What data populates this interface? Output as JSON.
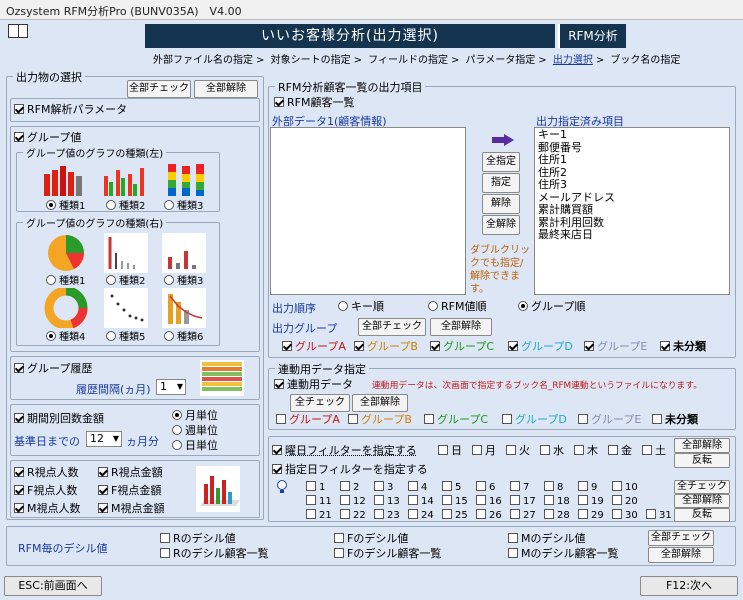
{
  "window": {
    "title": "Ozsystem RFM分析Pro (BUNV035A)　V4.00"
  },
  "header": {
    "title": "いいお客様分析(出力選択)",
    "badge": "RFM分析"
  },
  "nav": [
    {
      "label": "外部ファイル名の指定",
      "sep": ">"
    },
    {
      "label": "対象シートの指定",
      "sep": ">"
    },
    {
      "label": "フィールドの指定",
      "sep": ">"
    },
    {
      "label": "パラメータ指定",
      "sep": ">"
    },
    {
      "label": "出力選択",
      "sep": ">",
      "current": true
    },
    {
      "label": "ブック名の指定",
      "sep": ""
    }
  ],
  "output_section": {
    "title": "出力物の選択",
    "check_all": "全部チェック",
    "clear_all": "全部解除",
    "rfm_params": "RFM解析パラメータ",
    "group_values": "グループ値",
    "left_chart_title": "グループ値のグラフの種類(左)",
    "left_types": [
      "種類1",
      "種類2",
      "種類3"
    ],
    "right_chart_title": "グループ値のグラフの種類(右)",
    "right_types": [
      "種類1",
      "種類2",
      "種類3",
      "種類4",
      "種類5",
      "種類6"
    ],
    "history": "グループ履歴",
    "history_interval_label": "履歴間隔(ヵ月)",
    "history_interval_value": "1",
    "period_count": "期間別回数金額",
    "base_date_label": "基準日までの",
    "base_date_value": "12",
    "base_date_unit": "ヵ月分",
    "units": [
      "月単位",
      "週単位",
      "日単位"
    ],
    "viewpoints": [
      "R視点人数",
      "R視点金額",
      "F視点人数",
      "F視点金額",
      "M視点人数",
      "M視点金額"
    ]
  },
  "rfm_list": {
    "title": "RFM分析顧客一覧の出力項目",
    "rfm_customer_list": "RFM顧客一覧",
    "external_label": "外部データ1(顧客情報)",
    "specified_label": "出力指定済み項目",
    "specified_items": [
      "キー1",
      "郵便番号",
      "住所1",
      "住所2",
      "住所3",
      "メールアドレス",
      "累計購買額",
      "累計利用回数",
      "最終来店日"
    ],
    "btn_all_specify": "全指定",
    "btn_specify": "指定",
    "btn_release": "解除",
    "btn_all_release": "全解除",
    "hint": "ダブルクリックでも指定/解除できます。",
    "order_label": "出力順序",
    "order_options": [
      "キー順",
      "RFM値順",
      "グループ順"
    ],
    "group_label": "出力グループ",
    "check_all": "全部チェック",
    "clear_all": "全部解除",
    "groups": [
      "グループA",
      "グループB",
      "グループC",
      "グループD",
      "グループE",
      "未分類"
    ]
  },
  "link": {
    "title": "連動用データ指定",
    "link_data": "連動用データ",
    "note": "連動用データは、次画面で指定するブック名_RFM連動というファイルになります。",
    "check_all": "全チェック",
    "clear_all": "全部解除",
    "groups": [
      "グループA",
      "グループB",
      "グループC",
      "グループD",
      "グループE",
      "未分類"
    ]
  },
  "filters": {
    "weekday_filter": "曜日フィルターを指定する",
    "weekdays": [
      "日",
      "月",
      "火",
      "水",
      "木",
      "金",
      "土"
    ],
    "clear_all": "全部解除",
    "invert": "反転",
    "day_filter": "指定日フィルターを指定する",
    "check_all": "全チェック",
    "days": [
      "1",
      "2",
      "3",
      "4",
      "5",
      "6",
      "7",
      "8",
      "9",
      "10",
      "11",
      "12",
      "13",
      "14",
      "15",
      "16",
      "17",
      "18",
      "19",
      "20",
      "21",
      "22",
      "23",
      "24",
      "25",
      "26",
      "27",
      "28",
      "29",
      "30",
      "31"
    ]
  },
  "decile": {
    "title": "RFM毎のデシル値",
    "items": [
      "Rのデシル値",
      "Rのデシル顧客一覧",
      "Fのデシル値",
      "Fのデシル顧客一覧",
      "Mのデシル値",
      "Mのデシル顧客一覧"
    ],
    "check_all": "全部チェック",
    "clear_all": "全部解除"
  },
  "footer": {
    "back": "ESC:前画面へ",
    "next": "F12:次へ"
  },
  "colors": {
    "header_bg": "#13334f",
    "link_blue": "#1a3aa0",
    "note_red": "#c01818"
  }
}
